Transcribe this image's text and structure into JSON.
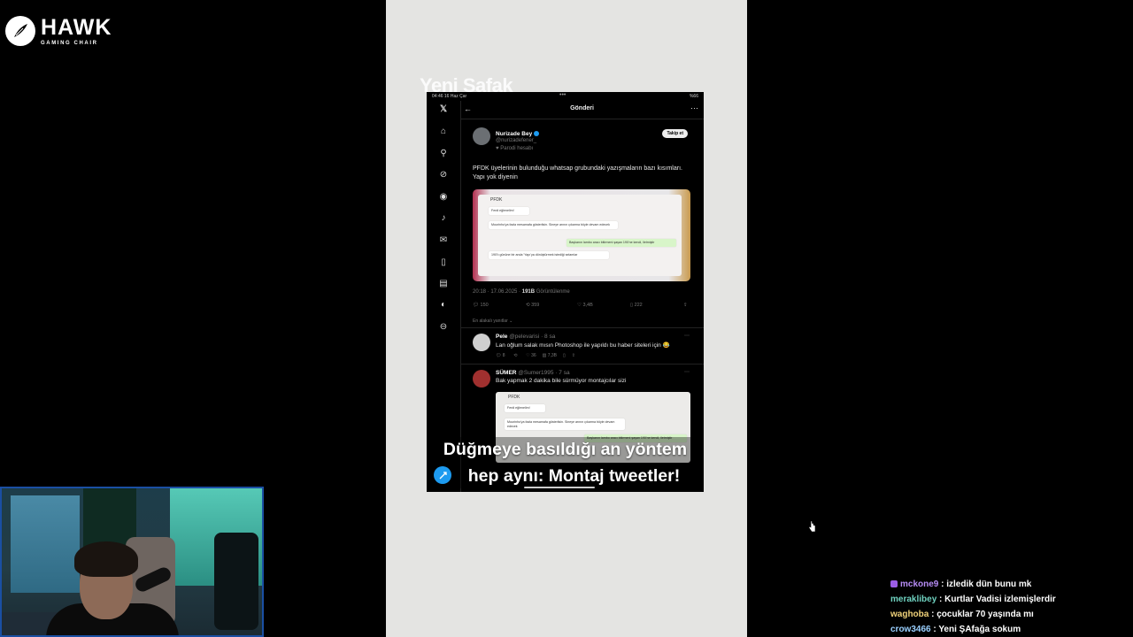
{
  "brand": {
    "name": "HAWK",
    "sub": "GAMING CHAIR"
  },
  "video": {
    "watermark": "Yeni Şafak",
    "status_bar": {
      "time": "04:46",
      "date": "16 Haz Çar",
      "right": "%66"
    },
    "header": {
      "title": "Gönderi"
    },
    "tweet": {
      "author": "Nurizade Bey",
      "handle": "@nurizadefener_",
      "parody": "Parodi hesabı",
      "follow_label": "Takip et",
      "text": "PFDK üyelerinin bulunduğu whatsap grubundaki yazışmaların bazı kısımları. Yapı yok diyenin",
      "media": {
        "chat_title": "PFDK",
        "messages": [
          "Ferdi eğlenelim!",
          "Mourinho'ya fazla mesamafa gösterilsin. Sineye arının çıkarma böyle devam edecek",
          "Başkanın lambo aracı bitirmeni şaşan 190'ne kendi, iletmiştir",
          "190'lı gününe bir anda 'Yapı'ya dönüştürmek istediği selamlar"
        ]
      },
      "time": "20:18 · 17.06.2025",
      "views_count": "191B",
      "views_label": "Görüntülenme",
      "actions": {
        "reply": "150",
        "retweet": "359",
        "like": "3,4B",
        "bookmark": "222"
      },
      "relevant_label": "En alakalı yanıtlar"
    },
    "replies": [
      {
        "name": "Pele",
        "handle": "@pelevarisi",
        "age": "· 8 sa",
        "text": "Lan oğlum salak mısın Photoshop ile yapıldı bu haber siteleri için 😂",
        "actions": {
          "reply": "8",
          "like": "36",
          "views": "7,3B"
        }
      },
      {
        "name": "SÜMER",
        "handle": "@Sumer1995",
        "age": "· 7 sa",
        "text": "Bak yapmak 2 dakika bile sürmüyor montajcılar sizi",
        "media_title": "PFDK"
      }
    ],
    "subtitle": {
      "line1": "Düğmeye basıldığı an yöntem",
      "line2": "hep aynı: Montaj tweetler!"
    }
  },
  "chat": [
    {
      "user": "mckone9",
      "color": "#b68cf5",
      "message": "izledik dün bunu mk",
      "badge": true
    },
    {
      "user": "meraklibey",
      "color": "#6fd2c0",
      "message": "Kurtlar Vadisi izlemişlerdir",
      "badge": false
    },
    {
      "user": "waghoba",
      "color": "#f0d27a",
      "message": "çocuklar 70 yaşında mı",
      "badge": false
    },
    {
      "user": "crow3466",
      "color": "#9ad0ff",
      "message": "Yeni ŞAfağa sokum",
      "badge": false
    }
  ]
}
